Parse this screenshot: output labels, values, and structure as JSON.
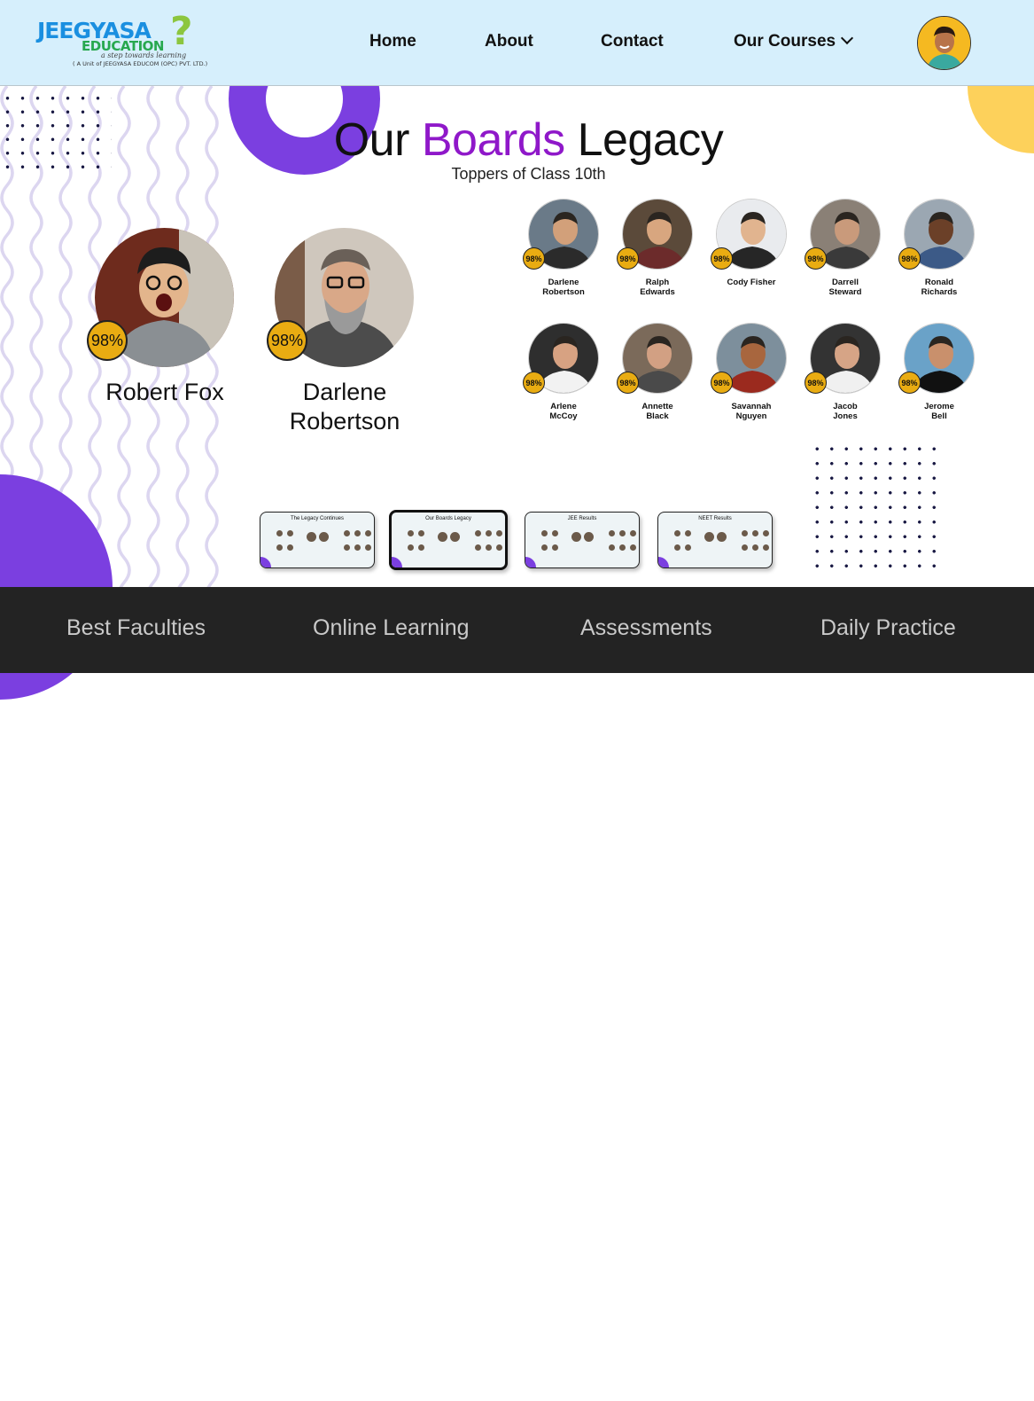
{
  "header": {
    "logo": {
      "brand_part1": "JEEGYASA",
      "brand_part2": "EDUCATION",
      "tagline": "a step towards learning",
      "unit": "( A Unit of JEEGYASA EDUCOM (OPC) PVT. LTD.)"
    },
    "nav": {
      "home": "Home",
      "about": "About",
      "contact": "Contact",
      "courses": "Our Courses"
    },
    "icons": {
      "courses_dropdown": "chevron-down-icon",
      "user": "user-avatar"
    }
  },
  "hero": {
    "title_before": "Our",
    "title_accent": "Boards",
    "title_after": "Legacy",
    "subtitle": "Toppers of Class 10th",
    "colors": {
      "accent": "#8f18c9",
      "purple": "#7b3fe0",
      "yellow": "#fdd15b",
      "badge": "#e9ac12"
    }
  },
  "big_toppers": [
    {
      "name": "Robert Fox",
      "score": "98%"
    },
    {
      "name": "Darlene Robertson",
      "score": "98%"
    }
  ],
  "small_toppers": [
    {
      "name": "Darlene\nRobertson",
      "score": "98%"
    },
    {
      "name": "Ralph\nEdwards",
      "score": "98%"
    },
    {
      "name": "Cody Fisher",
      "score": "98%"
    },
    {
      "name": "Darrell\nSteward",
      "score": "98%"
    },
    {
      "name": "Ronald\nRichards",
      "score": "98%"
    },
    {
      "name": "Arlene\nMcCoy",
      "score": "98%"
    },
    {
      "name": "Annette\nBlack",
      "score": "98%"
    },
    {
      "name": "Savannah\nNguyen",
      "score": "98%"
    },
    {
      "name": "Jacob\nJones",
      "score": "98%"
    },
    {
      "name": "Jerome\nBell",
      "score": "98%"
    }
  ],
  "carousel": [
    {
      "title": "The Legacy Continues",
      "active": false
    },
    {
      "title": "Our Boards Legacy",
      "active": true
    },
    {
      "title": "JEE Results",
      "active": false
    },
    {
      "title": "NEET Results",
      "active": false
    }
  ],
  "features": [
    "Best Faculties",
    "Online Learning",
    "Assessments",
    "Daily Practice"
  ]
}
